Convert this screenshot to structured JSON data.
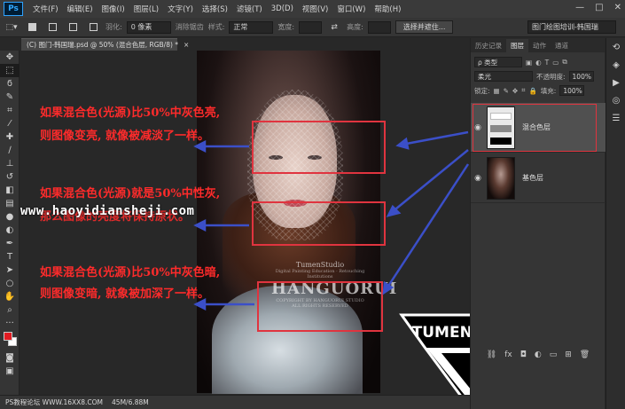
{
  "app": {
    "logo": "Ps"
  },
  "menu": [
    "文件(F)",
    "编辑(E)",
    "图像(I)",
    "图层(L)",
    "文字(Y)",
    "选择(S)",
    "滤镜(T)",
    "3D(D)",
    "视图(V)",
    "窗口(W)",
    "帮助(H)"
  ],
  "window_controls": [
    "—",
    "□",
    "✕"
  ],
  "options": {
    "feather_label": "羽化:",
    "feather_value": "0 像素",
    "antialias_label": "消除锯齿",
    "style_label": "样式:",
    "style_value": "正常",
    "width_label": "宽度:",
    "height_label": "高度:",
    "select_mask_button": "选择并遮住...",
    "workspace": "图门绘图培训-韩国瑞"
  },
  "document_tab": {
    "title": "(C) 图门-韩国瑞.psd @ 50% (混合色层, RGB/8) *",
    "close": "×"
  },
  "annotations": [
    {
      "line1": "如果混合色(光源)比50%中灰色亮,",
      "line2": "则图像变亮, 就像被减淡了一样。"
    },
    {
      "line1": "如果混合色(光源)就是50%中性灰,",
      "line2": "那么图像的亮度将保持原状。"
    },
    {
      "line1": "如果混合色(光源)比50%中灰色暗,",
      "line2": "则图像变暗, 就象被加深了一样。"
    }
  ],
  "watermark": "www.haoyidiansheji.com",
  "studio_mark": {
    "top": "TumenStudio",
    "sub": "Digital Painting Education · Retouching Institutions",
    "big": "HANGUORUI",
    "bottom": "COPYRIGHT BY HANGUORUI STUDIO ALL RIGHTS RESERVED"
  },
  "logo_text": "TUMENSTUDIO",
  "status": {
    "site": "PS教程论坛  WWW.16XX8.COM",
    "docsize": "45M/6.88M"
  },
  "panel": {
    "tabs": [
      "历史记录",
      "图层",
      "动作",
      "通道"
    ],
    "active_tab": "图层",
    "filter_kind": "ρ 类型",
    "blend_mode": "柔光",
    "opacity_label": "不透明度:",
    "opacity_value": "100%",
    "lock_label": "锁定:",
    "fill_label": "填充:",
    "fill_value": "100%",
    "layers": [
      {
        "name": "混合色层",
        "visible": true,
        "selected": true
      },
      {
        "name": "基色层",
        "visible": true,
        "selected": false
      }
    ],
    "bottom_icons": [
      "link-icon",
      "fx-icon",
      "mask-icon",
      "adjustment-icon",
      "folder-icon",
      "new-layer-icon",
      "trash-icon"
    ],
    "bottom_labels": [
      "⛓",
      "fx",
      "◘",
      "◐",
      "▭",
      "⊞",
      "🗑"
    ]
  },
  "colors": {
    "accent_red": "#e0343f",
    "annotation_red": "#ff2b2b",
    "arrow_blue": "#3b4fc8",
    "foreground": "#e11b22",
    "background": "#ffffff"
  }
}
